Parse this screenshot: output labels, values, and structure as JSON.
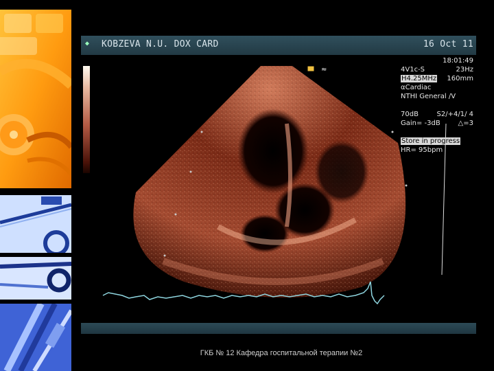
{
  "header": {
    "patient_name": "KOBZEVA N.U. DOX CARD",
    "date": "16 Oct 11"
  },
  "params": {
    "time": "18:01:49",
    "probe": "4V1c-S",
    "frame_rate": "23Hz",
    "frequency": "H4.25MHz",
    "depth": "160mm",
    "preset": "Cardiac",
    "mode": "NTHI General /V",
    "db": "70dB",
    "setting": "S2/+4/1/ 4",
    "gain": "Gain= -3dB",
    "delta": "=3",
    "status": "Store in progress",
    "heart_rate": "HR= 95bpm"
  },
  "footer": {
    "text": "ГКБ № 12 Кафедра госпитальной терапии №2"
  },
  "colors": {
    "header_bar": "#2a4652",
    "ecg_trace": "#8fd6e0",
    "echo_tissue": "#b45a40"
  },
  "icons": {
    "lightbulb": "lightbulb-icon",
    "marker": "orientation-marker-icon"
  }
}
